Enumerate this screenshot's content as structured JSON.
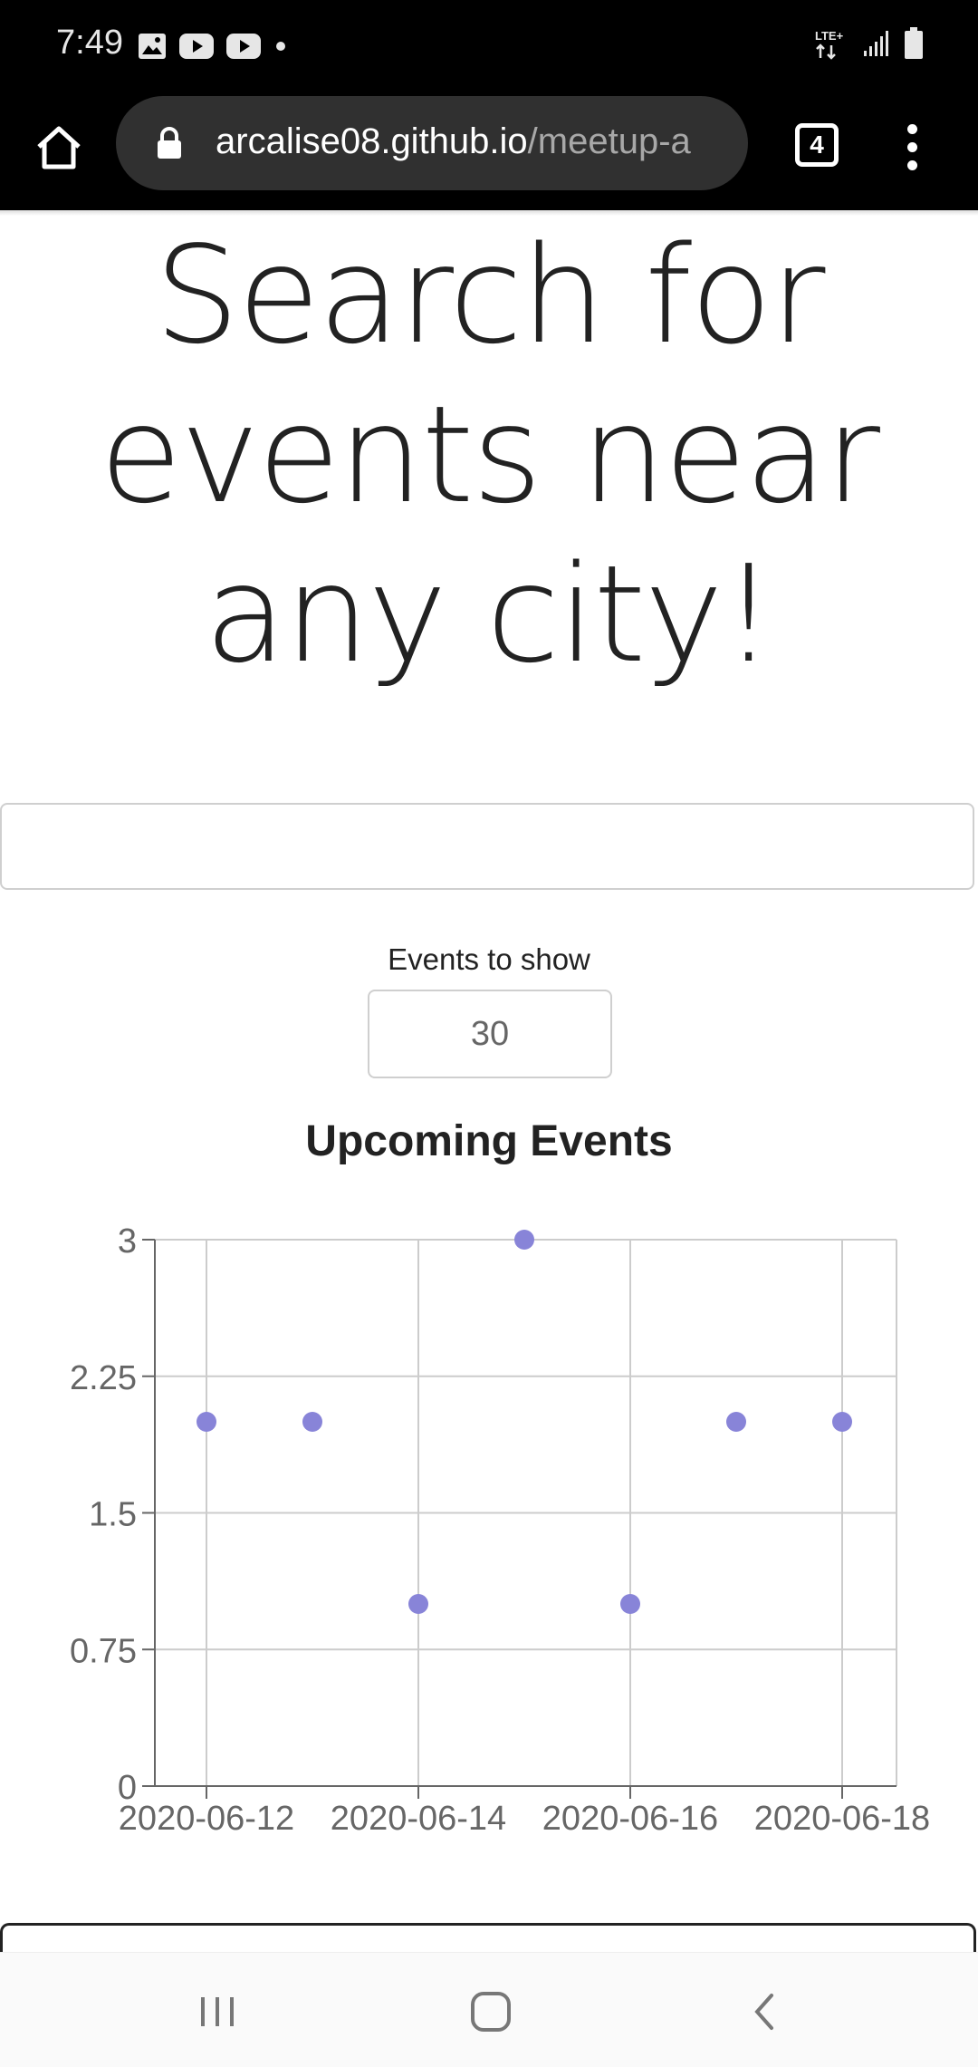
{
  "status_bar": {
    "time": "7:49",
    "left_icons": [
      "image-icon",
      "youtube-icon",
      "youtube-icon",
      "dot-icon"
    ],
    "right_icons": [
      "lte-icon",
      "signal-icon",
      "battery-icon"
    ],
    "network_label": "LTE+"
  },
  "browser": {
    "url_host": "arcalise08.github.io",
    "url_path": "/meetup-a",
    "tab_count": "4"
  },
  "page": {
    "title": "Search for events near any city!",
    "city_search": {
      "value": "",
      "placeholder": ""
    },
    "events_label": "Events to show",
    "events_value": "30",
    "chart_title": "Upcoming Events"
  },
  "colors": {
    "point": "#8884d8",
    "grid": "#cccccc",
    "axis": "#666666"
  },
  "chart_data": {
    "type": "scatter",
    "title": "Upcoming Events",
    "xlabel": "",
    "ylabel": "",
    "x_ticks": [
      "2020-06-12",
      "2020-06-14",
      "2020-06-16",
      "2020-06-18"
    ],
    "y_ticks": [
      "0",
      "0.75",
      "1.5",
      "2.25",
      "3"
    ],
    "ylim": [
      0,
      3
    ],
    "xlim": [
      "2020-06-12",
      "2020-06-18"
    ],
    "grid": true,
    "points": [
      {
        "x": "2020-06-12",
        "y": 2
      },
      {
        "x": "2020-06-13",
        "y": 2
      },
      {
        "x": "2020-06-14",
        "y": 1
      },
      {
        "x": "2020-06-15",
        "y": 3
      },
      {
        "x": "2020-06-16",
        "y": 1
      },
      {
        "x": "2020-06-17",
        "y": 2
      },
      {
        "x": "2020-06-18",
        "y": 2
      }
    ]
  },
  "nav_bar": {
    "buttons": [
      "recent-apps-icon",
      "home-icon",
      "back-icon"
    ]
  }
}
